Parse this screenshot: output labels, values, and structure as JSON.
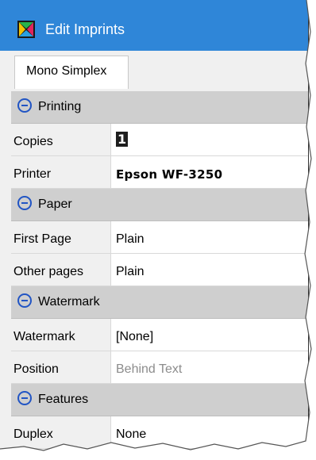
{
  "window": {
    "title": "Edit Imprints",
    "title_bar_color": "#2f86d8"
  },
  "tabs": [
    {
      "label": "Mono Simplex"
    }
  ],
  "sections": [
    {
      "title": "Printing",
      "rows": [
        {
          "label": "Copies",
          "value": "1",
          "style": "cursor"
        },
        {
          "label": "Printer",
          "value": "Epson WF-3250",
          "style": "bold"
        }
      ]
    },
    {
      "title": "Paper",
      "rows": [
        {
          "label": "First Page",
          "value": "Plain"
        },
        {
          "label": "Other pages",
          "value": "Plain"
        }
      ]
    },
    {
      "title": "Watermark",
      "rows": [
        {
          "label": "Watermark",
          "value": "[None]"
        },
        {
          "label": "Position",
          "value": "Behind Text",
          "style": "gray"
        }
      ]
    },
    {
      "title": "Features",
      "rows": [
        {
          "label": "Duplex",
          "value": "None"
        }
      ]
    }
  ],
  "icons": {
    "app": "app-logo-icon",
    "collapse": "collapse-minus-icon"
  }
}
